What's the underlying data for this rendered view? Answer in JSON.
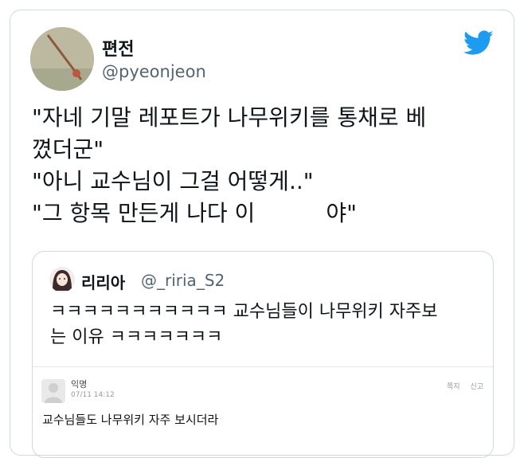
{
  "tweet": {
    "display_name": "편전",
    "handle": "@pyeonjeon",
    "text_lines": [
      "\"자네 기말 레포트가 나무위키를 통채로 베",
      "꼈더군\"",
      "\"아니 교수님이 그걸 어떻게..\"",
      "\"그 항목 만든게 나다 이          야\""
    ],
    "brand_icon": "twitter-bird-icon",
    "brand_color": "#1d9bf0"
  },
  "quote": {
    "display_name": "리리아",
    "handle": "@_riria_S2",
    "text_lines": [
      "ㅋㅋㅋㅋㅋㅋㅋㅋㅋㅋㅋ 교수님들이 나무위키 자주보",
      "는 이유 ㅋㅋㅋㅋㅋㅋㅋ"
    ],
    "embedded_post": {
      "author": "익명",
      "date": "07/11 14:12",
      "actions": [
        "쪽지",
        "신고"
      ],
      "text": "교수님들도 나무위키 자주 보시더라"
    }
  }
}
